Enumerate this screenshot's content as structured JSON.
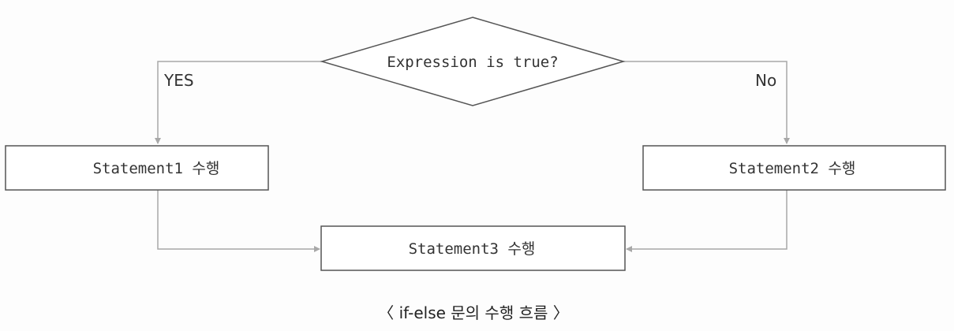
{
  "diagram": {
    "decision": "Expression is true?",
    "yes_label": "YES",
    "no_label": "No",
    "statement1": "Statement1 수행",
    "statement2": "Statement2 수행",
    "statement3": "Statement3 수행",
    "caption": "〈 if-else 문의 수행 흐름 〉",
    "colors": {
      "connector": "#a8a8a8",
      "shape_border": "#555555",
      "text": "#333333"
    }
  }
}
